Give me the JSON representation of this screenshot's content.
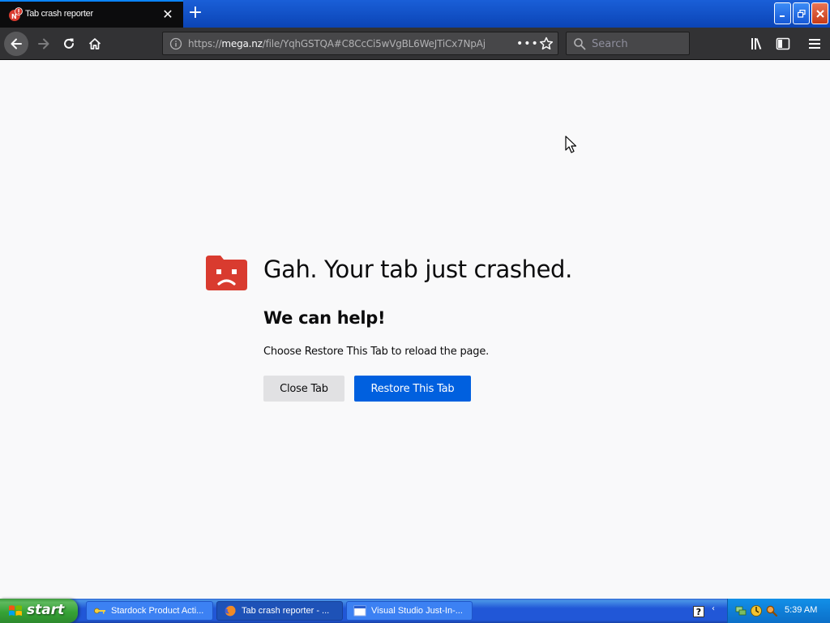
{
  "browser": {
    "tab": {
      "title": "Tab crash reporter"
    },
    "url": {
      "prefix": "https://",
      "host": "mega.nz",
      "path": "/file/YqhGSTQA#C8CcCi5wVgBL6WeJTiCx7NpAj"
    },
    "search": {
      "placeholder": "Search"
    }
  },
  "content": {
    "title": "Gah. Your tab just crashed.",
    "subtitle": "We can help!",
    "description": "Choose Restore This Tab to reload the page.",
    "close_tab_label": "Close Tab",
    "restore_label": "Restore This Tab"
  },
  "taskbar": {
    "start_label": "start",
    "tasks": [
      {
        "label": "Stardock Product Acti...",
        "icon": "key-icon"
      },
      {
        "label": "Tab crash reporter - ...",
        "icon": "firefox-icon",
        "active": true
      },
      {
        "label": "Visual Studio Just-In-...",
        "icon": "window-icon"
      }
    ],
    "help_label": "?",
    "clock": "5:39 AM"
  },
  "colors": {
    "accent": "#0060df",
    "crash_icon": "#d93b2f",
    "tab_bg": "#0c0c0d",
    "toolbar_bg": "#323234",
    "taskbar_blue": "#2157d7",
    "start_green": "#36a336"
  }
}
